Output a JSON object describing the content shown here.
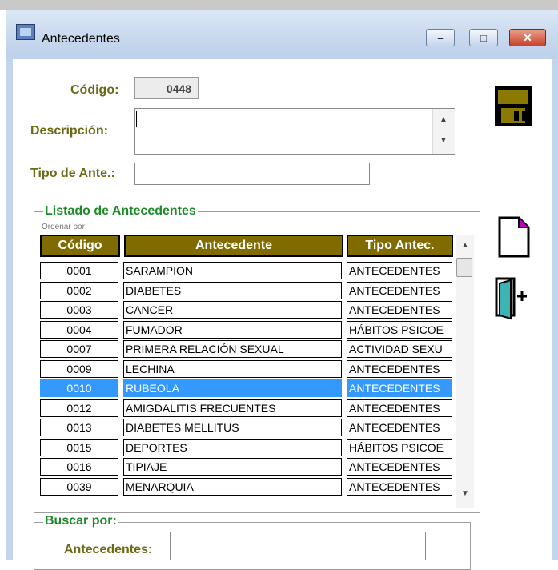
{
  "window": {
    "title": "Antecedentes",
    "minimize_icon": "minimize-icon",
    "maximize_icon": "maximize-icon",
    "close_icon": "close-icon"
  },
  "form": {
    "codigo_label": "Código:",
    "codigo_value": "0448",
    "descripcion_label": "Descripción:",
    "descripcion_value": "",
    "tipo_label": "Tipo de Ante.:",
    "tipo_value": ""
  },
  "listado": {
    "title": "Listado de Antecedentes",
    "ordenar_label": "Ordenar por:",
    "columns": [
      "Código",
      "Antecedente",
      "Tipo Antec."
    ],
    "rows": [
      {
        "codigo": "0001",
        "antecedente": "SARAMPION",
        "tipo": "ANTECEDENTES"
      },
      {
        "codigo": "0002",
        "antecedente": "DIABETES",
        "tipo": "ANTECEDENTES"
      },
      {
        "codigo": "0003",
        "antecedente": "CANCER",
        "tipo": "ANTECEDENTES"
      },
      {
        "codigo": "0004",
        "antecedente": "FUMADOR",
        "tipo": "HÁBITOS PSICOE"
      },
      {
        "codigo": "0007",
        "antecedente": "PRIMERA RELACIÓN SEXUAL",
        "tipo": "ACTIVIDAD SEXU"
      },
      {
        "codigo": "0009",
        "antecedente": "LECHINA",
        "tipo": "ANTECEDENTES"
      },
      {
        "codigo": "0010",
        "antecedente": "RUBEOLA",
        "tipo": "ANTECEDENTES"
      },
      {
        "codigo": "0012",
        "antecedente": "AMIGDALITIS FRECUENTES",
        "tipo": "ANTECEDENTES"
      },
      {
        "codigo": "0013",
        "antecedente": "DIABETES MELLITUS",
        "tipo": "ANTECEDENTES"
      },
      {
        "codigo": "0015",
        "antecedente": "DEPORTES",
        "tipo": "HÁBITOS PSICOE"
      },
      {
        "codigo": "0016",
        "antecedente": "TIPIAJE",
        "tipo": "ANTECEDENTES"
      },
      {
        "codigo": "0039",
        "antecedente": "MENARQUIA",
        "tipo": "ANTECEDENTES"
      }
    ],
    "selected_index": 6
  },
  "buscar": {
    "title": "Buscar por:",
    "antecedentes_label": "Antecedentes:"
  },
  "toolbar": {
    "save_icon": "floppy-disk-icon",
    "new_icon": "new-document-icon",
    "exit_icon": "exit-door-icon"
  },
  "colors": {
    "header_bg": "#7f6b00",
    "label_olive": "#6b6a14",
    "group_title_green": "#1f8a2a",
    "selection": "#3399ff"
  }
}
